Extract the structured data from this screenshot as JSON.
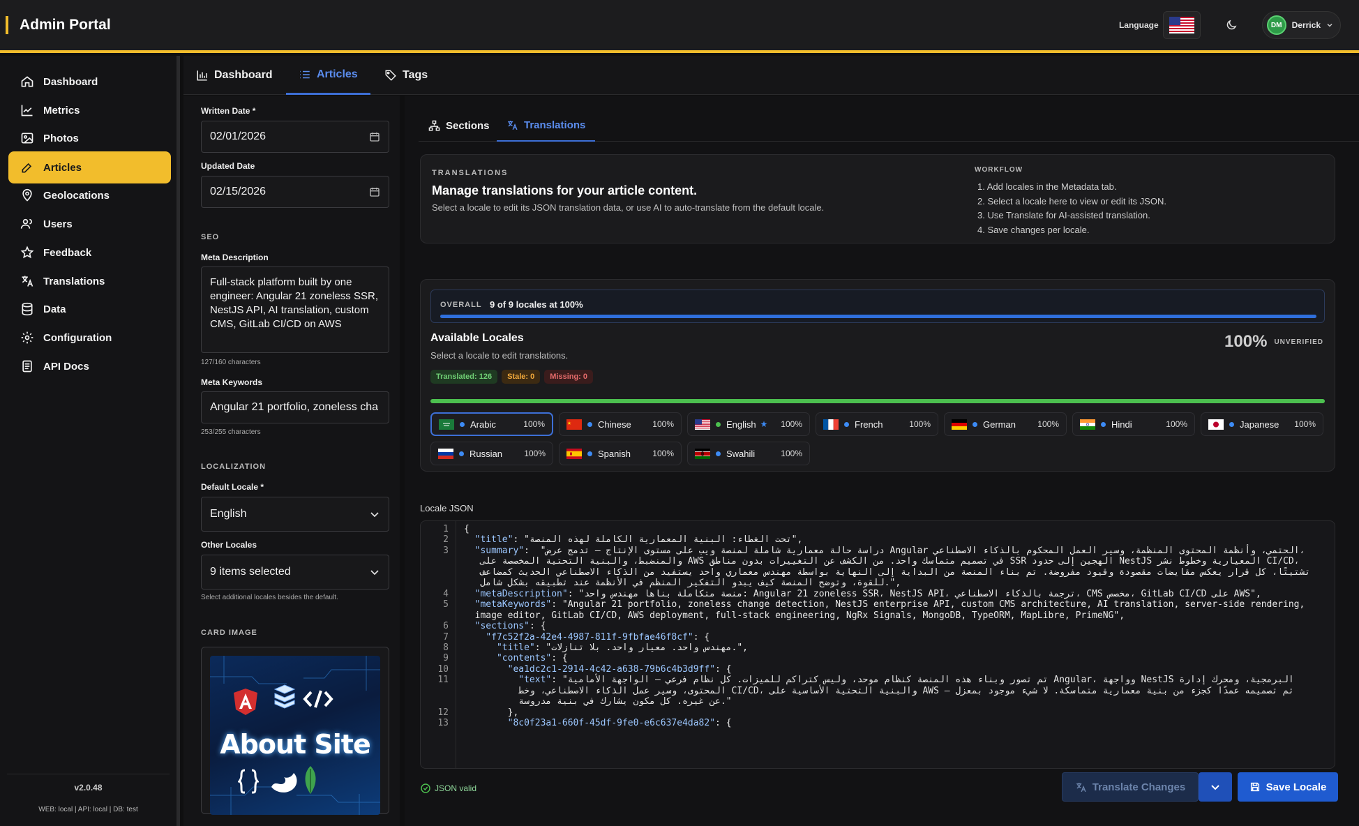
{
  "app": {
    "title": "Admin Portal",
    "language_label": "Language",
    "user_initials": "DM",
    "user_name": "Derrick"
  },
  "sidebar": {
    "items": [
      {
        "label": "Dashboard",
        "icon": "home-icon"
      },
      {
        "label": "Metrics",
        "icon": "chart-line-icon"
      },
      {
        "label": "Photos",
        "icon": "image-icon"
      },
      {
        "label": "Articles",
        "icon": "edit-icon",
        "active": true
      },
      {
        "label": "Geolocations",
        "icon": "map-pin-icon"
      },
      {
        "label": "Users",
        "icon": "users-icon"
      },
      {
        "label": "Feedback",
        "icon": "star-icon"
      },
      {
        "label": "Translations",
        "icon": "translate-icon"
      },
      {
        "label": "Data",
        "icon": "database-icon"
      },
      {
        "label": "Configuration",
        "icon": "gear-icon"
      },
      {
        "label": "API Docs",
        "icon": "document-icon"
      }
    ],
    "version": "v2.0.48",
    "env": "WEB: local  |  API: local  |  DB: test"
  },
  "tabs": [
    {
      "label": "Dashboard"
    },
    {
      "label": "Articles",
      "active": true
    },
    {
      "label": "Tags"
    }
  ],
  "form": {
    "written_date_label": "Written Date *",
    "written_date": "02/01/2026",
    "updated_date_label": "Updated Date",
    "updated_date": "02/15/2026",
    "seo_heading": "SEO",
    "meta_description_label": "Meta Description",
    "meta_description": "Full-stack platform built by one engineer: Angular 21 zoneless SSR, NestJS API, AI translation, custom CMS, GitLab CI/CD on AWS",
    "meta_description_count": "127/160 characters",
    "meta_keywords_label": "Meta Keywords",
    "meta_keywords": "Angular 21 portfolio, zoneless cha",
    "meta_keywords_count": "253/255 characters",
    "localization_heading": "LOCALIZATION",
    "default_locale_label": "Default Locale *",
    "default_locale": "English",
    "other_locales_label": "Other Locales",
    "other_locales": "9 items selected",
    "other_locales_hint": "Select additional locales besides the default.",
    "card_image_heading": "CARD IMAGE",
    "card_image_text": "About Site"
  },
  "subtabs": [
    {
      "label": "Sections"
    },
    {
      "label": "Translations",
      "active": true
    }
  ],
  "info": {
    "caps": "TRANSLATIONS",
    "title": "Manage translations for your article content.",
    "desc": "Select a locale to edit its JSON translation data, or use AI to auto-translate from the default locale.",
    "workflow_heading": "WORKFLOW",
    "steps": [
      "1. Add locales in the Metadata tab.",
      "2. Select a locale here to view or edit its JSON.",
      "3. Use Translate for AI-assisted translation.",
      "4. Save changes per locale."
    ]
  },
  "overall": {
    "label": "OVERALL",
    "value": "9 of 9 locales at 100%",
    "progress": 1.0
  },
  "locales_panel": {
    "title": "Available Locales",
    "subtitle": "Select a locale to edit translations.",
    "percent": "100%",
    "status": "UNVERIFIED",
    "translated": "Translated: 126",
    "stale": "Stale: 0",
    "missing": "Missing: 0",
    "locales": [
      {
        "name": "Arabic",
        "pct": "100%",
        "flag": "sa",
        "selected": true
      },
      {
        "name": "Chinese",
        "pct": "100%",
        "flag": "cn"
      },
      {
        "name": "English",
        "pct": "100%",
        "flag": "us",
        "star": "★"
      },
      {
        "name": "French",
        "pct": "100%",
        "flag": "fr"
      },
      {
        "name": "German",
        "pct": "100%",
        "flag": "de"
      },
      {
        "name": "Hindi",
        "pct": "100%",
        "flag": "in"
      },
      {
        "name": "Japanese",
        "pct": "100%",
        "flag": "jp"
      },
      {
        "name": "Russian",
        "pct": "100%",
        "flag": "ru"
      },
      {
        "name": "Spanish",
        "pct": "100%",
        "flag": "es"
      },
      {
        "name": "Swahili",
        "pct": "100%",
        "flag": "ke"
      }
    ]
  },
  "json_editor": {
    "label": "Locale JSON",
    "status": "JSON valid",
    "lines": [
      {
        "n": "1",
        "t": "{"
      },
      {
        "n": "2",
        "t": "  \"title\": \"تحت الغطاء: البنية المعمارية الكاملة لهذه المنصة\","
      },
      {
        "n": "3",
        "t": "  \"summary\":  \"دراسة حالة معمارية شاملة لمنصة ويب على مستوى الإنتاج — تدمج عرض Angular الحتمي، وأنظمة المحتوى المنظمة، وسير العمل المحكوم بالذكاء الاصطناعي،"
      },
      {
        "n": "",
        "t": "   والمنضبط، والبنية التحتية المخصصة على AWS في تصميم متماسك واحد. من الكشف عن التغييرات بدون مناطق SSR الهجين إلى حدود NestJS المعيارية وخطوط نشر CI/CD،"
      },
      {
        "n": "",
        "t": "   تشتيتًا، كل قرار يعكس مقايضات مقصودة وقيود مفروضة. تم بناء المنصة من البداية إلى النهاية بواسطة مهندس معماري واحد يستفيد من الذكاء الاصطناعي الحديث كمضاعف"
      },
      {
        "n": "",
        "t": "   للقوة، وتوضح المنصة كيف يبدو التفكير المنظم في الأنظمة عند تطبيقه بشكل شامل.\","
      },
      {
        "n": "4",
        "t": "  \"metaDescription\": \"منصة متكاملة بناها مهندس واحد: Angular 21 zoneless SSR، NestJS API، ترجمة بالذكاء الاصطناعي، CMS مخصص، GitLab CI/CD على AWS\","
      },
      {
        "n": "5",
        "t": "  \"metaKeywords\": \"Angular 21 portfolio, zoneless change detection, NestJS enterprise API, custom CMS architecture, AI translation, server-side rendering,"
      },
      {
        "n": "",
        "t": "  image editor, GitLab CI/CD, AWS deployment, full-stack engineering, NgRx Signals, MongoDB, TypeORM, MapLibre, PrimeNG\","
      },
      {
        "n": "6",
        "t": "  \"sections\": {"
      },
      {
        "n": "7",
        "t": "    \"f7c52f2a-42e4-4987-811f-9fbfae46f8cf\": {"
      },
      {
        "n": "8",
        "t": "      \"title\": \"مهندس واحد. معيار واحد. بلا تنازلات.\","
      },
      {
        "n": "9",
        "t": "      \"contents\": {"
      },
      {
        "n": "10",
        "t": "        \"ea1dc2c1-2914-4c42-a638-79b6c4b3d9ff\": {"
      },
      {
        "n": "11",
        "t": "          \"text\": \"تم تصور وبناء هذه المنصة كنظام موحد، وليس كتراكم للميزات. كل نظام فرعي — الواجهة الأمامية Angular، وواجهة NestJS البرمجية، ومحرك إدارة"
      },
      {
        "n": "",
        "t": "          المحتوى، وسير عمل الذكاء الاصطناعي، وخط CI/CD، والبنية التحتية الأساسية على AWS — تم تصميمه عمدًا كجزء من بنية معمارية متماسكة. لا شيء موجود بمعزل"
      },
      {
        "n": "",
        "t": "          عن غيره. كل مكون يشارك في بنية مدروسة.\""
      },
      {
        "n": "12",
        "t": "        },"
      },
      {
        "n": "13",
        "t": "        \"8c0f23a1-660f-45df-9fe0-e6c637e4da82\": {"
      }
    ]
  },
  "actions": {
    "translate": "Translate Changes",
    "save": "Save Locale"
  },
  "colors": {
    "accent": "#f2bd2c",
    "primary": "#3d6fd6",
    "success": "#4cc04f",
    "surface": "#1b1b1d"
  }
}
